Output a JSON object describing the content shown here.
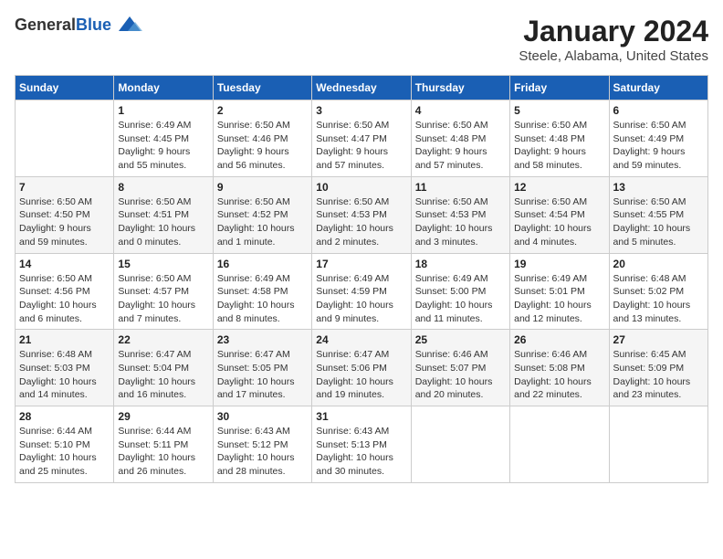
{
  "header": {
    "logo_general": "General",
    "logo_blue": "Blue",
    "month_year": "January 2024",
    "location": "Steele, Alabama, United States"
  },
  "days_of_week": [
    "Sunday",
    "Monday",
    "Tuesday",
    "Wednesday",
    "Thursday",
    "Friday",
    "Saturday"
  ],
  "weeks": [
    [
      {
        "day": "",
        "info": ""
      },
      {
        "day": "1",
        "info": "Sunrise: 6:49 AM\nSunset: 4:45 PM\nDaylight: 9 hours\nand 55 minutes."
      },
      {
        "day": "2",
        "info": "Sunrise: 6:50 AM\nSunset: 4:46 PM\nDaylight: 9 hours\nand 56 minutes."
      },
      {
        "day": "3",
        "info": "Sunrise: 6:50 AM\nSunset: 4:47 PM\nDaylight: 9 hours\nand 57 minutes."
      },
      {
        "day": "4",
        "info": "Sunrise: 6:50 AM\nSunset: 4:48 PM\nDaylight: 9 hours\nand 57 minutes."
      },
      {
        "day": "5",
        "info": "Sunrise: 6:50 AM\nSunset: 4:48 PM\nDaylight: 9 hours\nand 58 minutes."
      },
      {
        "day": "6",
        "info": "Sunrise: 6:50 AM\nSunset: 4:49 PM\nDaylight: 9 hours\nand 59 minutes."
      }
    ],
    [
      {
        "day": "7",
        "info": "Sunrise: 6:50 AM\nSunset: 4:50 PM\nDaylight: 9 hours\nand 59 minutes."
      },
      {
        "day": "8",
        "info": "Sunrise: 6:50 AM\nSunset: 4:51 PM\nDaylight: 10 hours\nand 0 minutes."
      },
      {
        "day": "9",
        "info": "Sunrise: 6:50 AM\nSunset: 4:52 PM\nDaylight: 10 hours\nand 1 minute."
      },
      {
        "day": "10",
        "info": "Sunrise: 6:50 AM\nSunset: 4:53 PM\nDaylight: 10 hours\nand 2 minutes."
      },
      {
        "day": "11",
        "info": "Sunrise: 6:50 AM\nSunset: 4:53 PM\nDaylight: 10 hours\nand 3 minutes."
      },
      {
        "day": "12",
        "info": "Sunrise: 6:50 AM\nSunset: 4:54 PM\nDaylight: 10 hours\nand 4 minutes."
      },
      {
        "day": "13",
        "info": "Sunrise: 6:50 AM\nSunset: 4:55 PM\nDaylight: 10 hours\nand 5 minutes."
      }
    ],
    [
      {
        "day": "14",
        "info": "Sunrise: 6:50 AM\nSunset: 4:56 PM\nDaylight: 10 hours\nand 6 minutes."
      },
      {
        "day": "15",
        "info": "Sunrise: 6:50 AM\nSunset: 4:57 PM\nDaylight: 10 hours\nand 7 minutes."
      },
      {
        "day": "16",
        "info": "Sunrise: 6:49 AM\nSunset: 4:58 PM\nDaylight: 10 hours\nand 8 minutes."
      },
      {
        "day": "17",
        "info": "Sunrise: 6:49 AM\nSunset: 4:59 PM\nDaylight: 10 hours\nand 9 minutes."
      },
      {
        "day": "18",
        "info": "Sunrise: 6:49 AM\nSunset: 5:00 PM\nDaylight: 10 hours\nand 11 minutes."
      },
      {
        "day": "19",
        "info": "Sunrise: 6:49 AM\nSunset: 5:01 PM\nDaylight: 10 hours\nand 12 minutes."
      },
      {
        "day": "20",
        "info": "Sunrise: 6:48 AM\nSunset: 5:02 PM\nDaylight: 10 hours\nand 13 minutes."
      }
    ],
    [
      {
        "day": "21",
        "info": "Sunrise: 6:48 AM\nSunset: 5:03 PM\nDaylight: 10 hours\nand 14 minutes."
      },
      {
        "day": "22",
        "info": "Sunrise: 6:47 AM\nSunset: 5:04 PM\nDaylight: 10 hours\nand 16 minutes."
      },
      {
        "day": "23",
        "info": "Sunrise: 6:47 AM\nSunset: 5:05 PM\nDaylight: 10 hours\nand 17 minutes."
      },
      {
        "day": "24",
        "info": "Sunrise: 6:47 AM\nSunset: 5:06 PM\nDaylight: 10 hours\nand 19 minutes."
      },
      {
        "day": "25",
        "info": "Sunrise: 6:46 AM\nSunset: 5:07 PM\nDaylight: 10 hours\nand 20 minutes."
      },
      {
        "day": "26",
        "info": "Sunrise: 6:46 AM\nSunset: 5:08 PM\nDaylight: 10 hours\nand 22 minutes."
      },
      {
        "day": "27",
        "info": "Sunrise: 6:45 AM\nSunset: 5:09 PM\nDaylight: 10 hours\nand 23 minutes."
      }
    ],
    [
      {
        "day": "28",
        "info": "Sunrise: 6:44 AM\nSunset: 5:10 PM\nDaylight: 10 hours\nand 25 minutes."
      },
      {
        "day": "29",
        "info": "Sunrise: 6:44 AM\nSunset: 5:11 PM\nDaylight: 10 hours\nand 26 minutes."
      },
      {
        "day": "30",
        "info": "Sunrise: 6:43 AM\nSunset: 5:12 PM\nDaylight: 10 hours\nand 28 minutes."
      },
      {
        "day": "31",
        "info": "Sunrise: 6:43 AM\nSunset: 5:13 PM\nDaylight: 10 hours\nand 30 minutes."
      },
      {
        "day": "",
        "info": ""
      },
      {
        "day": "",
        "info": ""
      },
      {
        "day": "",
        "info": ""
      }
    ]
  ]
}
